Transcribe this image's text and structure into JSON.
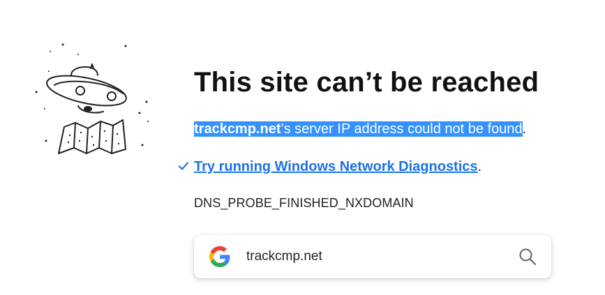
{
  "page": {
    "title": "This site can’t be reached",
    "error": {
      "host": "trackcmp.net",
      "message": "’s server IP address could not be found",
      "suffix": "."
    },
    "diagnostics": {
      "link_label": "Try running Windows Network Diagnostics",
      "suffix": ".",
      "check_icon": "checkmark-icon"
    },
    "error_code": "DNS_PROBE_FINISHED_NXDOMAIN"
  },
  "search": {
    "query": "trackcmp.net",
    "logo_icon": "google-g-icon",
    "search_icon": "magnifier-icon"
  },
  "colors": {
    "selection": "#3392ff",
    "link": "#1a73e8",
    "google_blue": "#4285F4",
    "google_red": "#EA4335",
    "google_yellow": "#FBBC05",
    "google_green": "#34A853"
  }
}
